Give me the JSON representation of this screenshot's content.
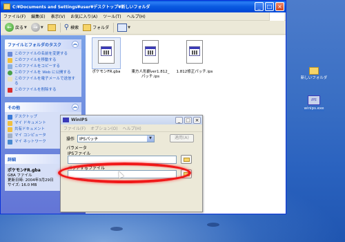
{
  "explorer": {
    "title": "C:¥Documents and Settings¥user¥デスクトップ¥新しいフォルダ",
    "menu": [
      "ファイル(F)",
      "編集(E)",
      "表示(V)",
      "お気に入り(A)",
      "ツール(T)",
      "ヘルプ(H)"
    ],
    "toolbar": {
      "back": "戻る",
      "search": "検索",
      "folders": "フォルダ"
    },
    "file_tasks": {
      "title": "ファイルとフォルダのタスク",
      "items": [
        "このファイルの名前を変更する",
        "このファイルを移動する",
        "このファイルをコピーする",
        "このファイルを Web に公開する",
        "このファイルを電子メールで送信する",
        "このファイルを削除する"
      ]
    },
    "other_places": {
      "title": "その他",
      "items": [
        "デスクトップ",
        "マイ ドキュメント",
        "共有ドキュメント",
        "マイ コンピュータ",
        "マイ ネットワーク"
      ]
    },
    "details": {
      "title": "詳細",
      "name": "ポケモンFR.gba",
      "type": "GBA ファイル",
      "modified": "更新日時: 2004年3月29日",
      "size": "サイズ: 16.0 MB"
    },
    "files": [
      {
        "name": "ポケモンFR.gba"
      },
      {
        "name": "東方人形劇ver1.812_パッチ.ips"
      },
      {
        "name": "1.812修正パッチ.ips"
      }
    ]
  },
  "dialog": {
    "title": "WinIPS",
    "menu": [
      "ファイル(F)",
      "オプション(O)",
      "ヘルプ(H)"
    ],
    "operation_label": "操作",
    "operation_value": "IPSパッチ",
    "run_label": "適用(A)",
    "params_label": "パラメータ",
    "ips_file_label": "IPSファイル",
    "target_file_label": "パッチするファイル"
  },
  "desktop": {
    "icons": [
      {
        "label": "新しいフォルダ"
      },
      {
        "label": "winips.exe"
      }
    ]
  }
}
